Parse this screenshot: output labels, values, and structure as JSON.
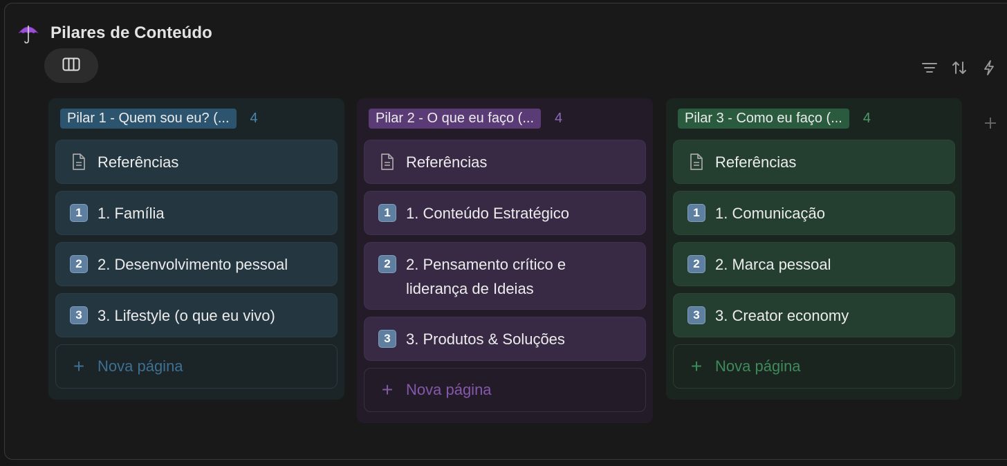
{
  "page": {
    "title": "Pilares de Conteúdo",
    "icon": "umbrella-icon"
  },
  "toolbar": {
    "view_icon": "board-view-icon",
    "icons": [
      "filter-icon",
      "sort-icon",
      "automation-bolt-icon"
    ]
  },
  "add_group_icon": "plus-icon",
  "columns": [
    {
      "title": "Pilar 1 - Quem sou eu? (...",
      "count": "4",
      "color": "#2c546e",
      "cards": [
        {
          "icon": "document-icon",
          "label": "Referências"
        },
        {
          "icon": "keycap-1-icon",
          "badge": "1",
          "label": "1. Família"
        },
        {
          "icon": "keycap-2-icon",
          "badge": "2",
          "label": "2. Desenvolvimento pessoal"
        },
        {
          "icon": "keycap-3-icon",
          "badge": "3",
          "label": "3. Lifestyle (o que eu vivo)"
        }
      ],
      "new_page": "Nova página"
    },
    {
      "title": "Pilar 2 - O que eu faço (...",
      "count": "4",
      "color": "#5a3b76",
      "cards": [
        {
          "icon": "document-icon",
          "label": "Referências"
        },
        {
          "icon": "keycap-1-icon",
          "badge": "1",
          "label": "1. Conteúdo Estratégico"
        },
        {
          "icon": "keycap-2-icon",
          "badge": "2",
          "label": "2. Pensamento crítico e liderança de Ideias"
        },
        {
          "icon": "keycap-3-icon",
          "badge": "3",
          "label": "3. Produtos & Soluções"
        }
      ],
      "new_page": "Nova página"
    },
    {
      "title": "Pilar 3 - Como eu faço (...",
      "count": "4",
      "color": "#2b5b3f",
      "cards": [
        {
          "icon": "document-icon",
          "label": "Referências"
        },
        {
          "icon": "keycap-1-icon",
          "badge": "1",
          "label": "1. Comunicação"
        },
        {
          "icon": "keycap-2-icon",
          "badge": "2",
          "label": "2. Marca pessoal"
        },
        {
          "icon": "keycap-3-icon",
          "badge": "3",
          "label": "3. Creator economy"
        }
      ],
      "new_page": "Nova página"
    }
  ]
}
